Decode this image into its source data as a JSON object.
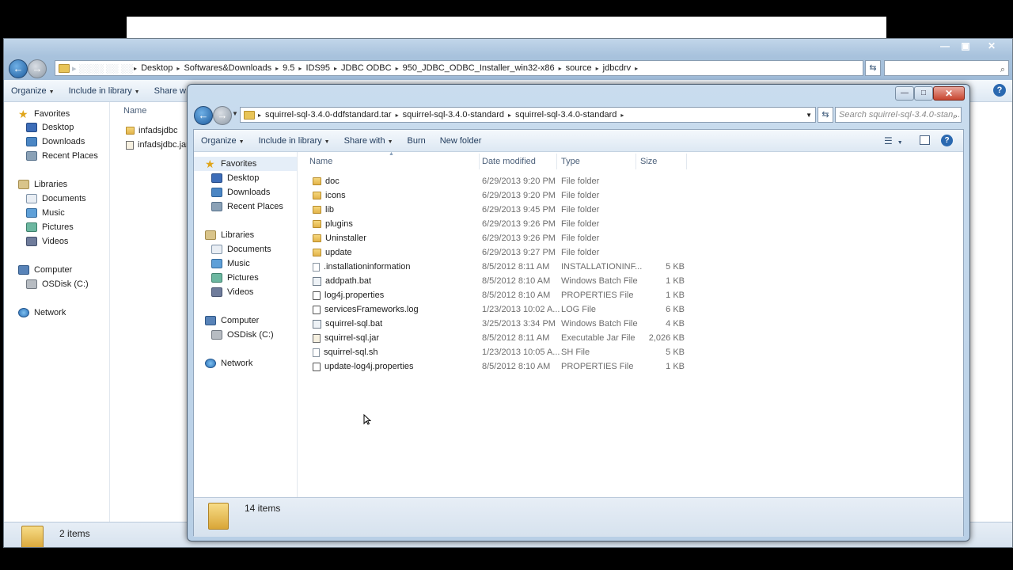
{
  "back_window": {
    "address_segments": [
      "Desktop",
      "Softwares&Downloads",
      "9.5",
      "IDS95",
      "JDBC ODBC",
      "950_JDBC_ODBC_Installer_win32-x86",
      "source",
      "jdbcdrv"
    ],
    "toolbar": {
      "organize": "Organize",
      "include_in_library": "Include in library",
      "share_with": "Share w"
    },
    "column_name": "Name",
    "nav": {
      "favorites": "Favorites",
      "desktop": "Desktop",
      "downloads": "Downloads",
      "recent_places": "Recent Places",
      "libraries": "Libraries",
      "documents": "Documents",
      "music": "Music",
      "pictures": "Pictures",
      "videos": "Videos",
      "computer": "Computer",
      "osdisk": "OSDisk (C:)",
      "network": "Network"
    },
    "files": [
      "infadsjdbc",
      "infadsjdbc.jar"
    ],
    "status": "2 items"
  },
  "front_window": {
    "address_segments": [
      "squirrel-sql-3.4.0-ddfstandard.tar",
      "squirrel-sql-3.4.0-standard",
      "squirrel-sql-3.4.0-standard"
    ],
    "search_placeholder": "Search squirrel-sql-3.4.0-stan...",
    "toolbar": {
      "organize": "Organize",
      "include_in_library": "Include in library",
      "share_with": "Share with",
      "burn": "Burn",
      "new_folder": "New folder"
    },
    "columns": {
      "name": "Name",
      "date_modified": "Date modified",
      "type": "Type",
      "size": "Size"
    },
    "nav": {
      "favorites": "Favorites",
      "desktop": "Desktop",
      "downloads": "Downloads",
      "recent_places": "Recent Places",
      "libraries": "Libraries",
      "documents": "Documents",
      "music": "Music",
      "pictures": "Pictures",
      "videos": "Videos",
      "computer": "Computer",
      "osdisk": "OSDisk (C:)",
      "network": "Network"
    },
    "files": [
      {
        "name": "doc",
        "date": "6/29/2013 9:20 PM",
        "type": "File folder",
        "size": "",
        "icon": "folder"
      },
      {
        "name": "icons",
        "date": "6/29/2013 9:20 PM",
        "type": "File folder",
        "size": "",
        "icon": "folder"
      },
      {
        "name": "lib",
        "date": "6/29/2013 9:45 PM",
        "type": "File folder",
        "size": "",
        "icon": "folder"
      },
      {
        "name": "plugins",
        "date": "6/29/2013 9:26 PM",
        "type": "File folder",
        "size": "",
        "icon": "folder"
      },
      {
        "name": "Uninstaller",
        "date": "6/29/2013 9:26 PM",
        "type": "File folder",
        "size": "",
        "icon": "folder"
      },
      {
        "name": "update",
        "date": "6/29/2013 9:27 PM",
        "type": "File folder",
        "size": "",
        "icon": "folder"
      },
      {
        "name": ".installationinformation",
        "date": "8/5/2012 8:11 AM",
        "type": "INSTALLATIONINF...",
        "size": "5 KB",
        "icon": "file"
      },
      {
        "name": "addpath.bat",
        "date": "8/5/2012 8:10 AM",
        "type": "Windows Batch File",
        "size": "1 KB",
        "icon": "bat"
      },
      {
        "name": "log4j.properties",
        "date": "8/5/2012 8:10 AM",
        "type": "PROPERTIES File",
        "size": "1 KB",
        "icon": "prop"
      },
      {
        "name": "servicesFrameworks.log",
        "date": "1/23/2013 10:02 A...",
        "type": "LOG File",
        "size": "6 KB",
        "icon": "prop"
      },
      {
        "name": "squirrel-sql.bat",
        "date": "3/25/2013 3:34 PM",
        "type": "Windows Batch File",
        "size": "4 KB",
        "icon": "bat"
      },
      {
        "name": "squirrel-sql.jar",
        "date": "8/5/2012 8:11 AM",
        "type": "Executable Jar File",
        "size": "2,026 KB",
        "icon": "jar"
      },
      {
        "name": "squirrel-sql.sh",
        "date": "1/23/2013 10:05 A...",
        "type": "SH File",
        "size": "5 KB",
        "icon": "file"
      },
      {
        "name": "update-log4j.properties",
        "date": "8/5/2012 8:10 AM",
        "type": "PROPERTIES File",
        "size": "1 KB",
        "icon": "prop"
      }
    ],
    "status": "14 items"
  }
}
